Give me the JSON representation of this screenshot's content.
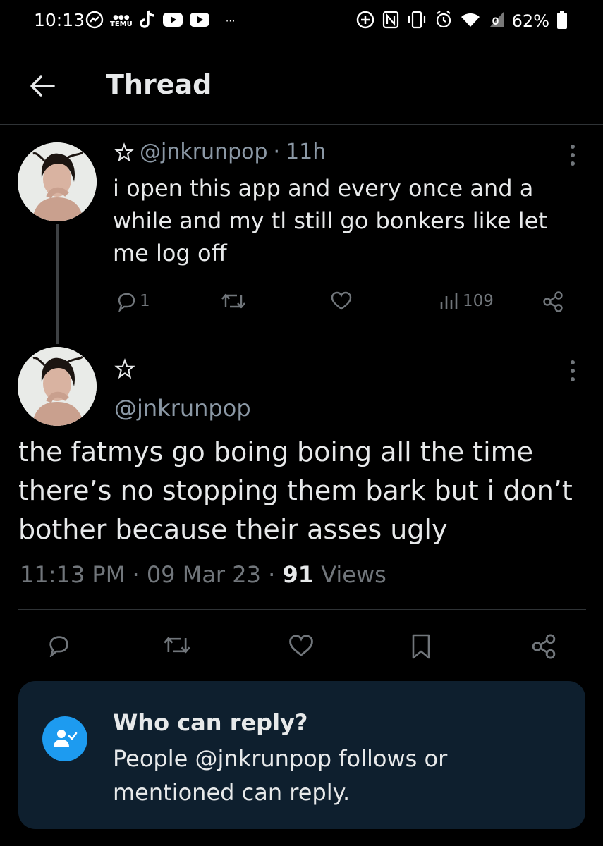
{
  "status_bar": {
    "time": "10:13",
    "temu_label": "TEMU",
    "battery": "62%",
    "signal_label": "0"
  },
  "header": {
    "title": "Thread"
  },
  "tweets": [
    {
      "handle": "@jnkrunpop",
      "sep": "·",
      "time": "11h",
      "text": "i open this app and every once and a while and my tl still go bonkers like let me log off",
      "reply_count": "1",
      "view_count": "109"
    },
    {
      "handle": "@jnkrunpop",
      "text": "the fatmys go boing boing all the time there’s no stopping them bark but i don’t bother because their asses ugly",
      "timestamp": "11:13 PM",
      "sep": "·",
      "date": "09 Mar 23",
      "views_number": "91",
      "views_label": "Views"
    }
  ],
  "reply_restriction": {
    "title": "Who can reply?",
    "description": "People @jnkrunpop follows or mentioned can reply."
  },
  "colors": {
    "accent": "#1d9bf0",
    "background": "#000000",
    "card": "#0e1f2e"
  }
}
